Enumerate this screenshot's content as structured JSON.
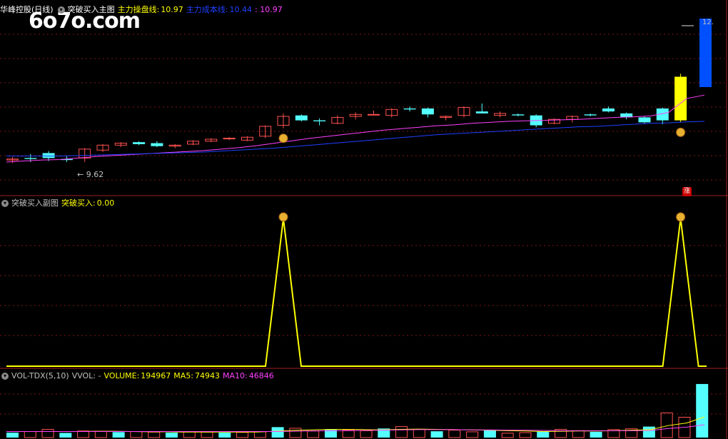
{
  "watermark": "6o7o.com",
  "main": {
    "stock_label": "华峰控股(日线)",
    "indicator_name": "突破买入主图",
    "line1_label": "主力操盘线:",
    "line1_value": "10.97",
    "line2_label": "主力成本线:",
    "line2_value": "10.44",
    "line2_value2": ": 10.97",
    "low_marker": "9.62",
    "high_marker": "12.",
    "zhang_label": "涨"
  },
  "sub": {
    "indicator_name": "突破买入副图",
    "signal_label": "突破买入:",
    "signal_value": "0.00"
  },
  "vol": {
    "indicator_name": "VOL-TDX(5,10)",
    "vvol": "VVOL: -",
    "volume_label": "VOLUME:",
    "volume_value": "194967",
    "ma5_label": "MA5:",
    "ma5_value": "74943",
    "ma10_label": "MA10:",
    "ma10_value": "46846"
  },
  "colors": {
    "up": "#ff5050",
    "down": "#54ffff",
    "ma_pink": "#ff40ff",
    "ma_blue": "#2040ff",
    "signal": "#ffff00",
    "bullish_bar": "#ffff00",
    "blue_bar": "#0050ff"
  },
  "chart_data": {
    "type": "candlestick",
    "ylim": [
      9.0,
      12.6
    ],
    "candles": [
      {
        "o": 9.66,
        "h": 9.72,
        "l": 9.6,
        "c": 9.68
      },
      {
        "o": 9.7,
        "h": 9.78,
        "l": 9.62,
        "c": 9.68
      },
      {
        "o": 9.8,
        "h": 9.84,
        "l": 9.64,
        "c": 9.7
      },
      {
        "o": 9.68,
        "h": 9.74,
        "l": 9.62,
        "c": 9.66
      },
      {
        "o": 9.7,
        "h": 9.9,
        "l": 9.62,
        "c": 9.88
      },
      {
        "o": 9.86,
        "h": 9.98,
        "l": 9.82,
        "c": 9.96
      },
      {
        "o": 9.96,
        "h": 10.02,
        "l": 9.92,
        "c": 10.0
      },
      {
        "o": 10.02,
        "h": 10.04,
        "l": 9.96,
        "c": 9.98
      },
      {
        "o": 10.0,
        "h": 10.04,
        "l": 9.92,
        "c": 9.94
      },
      {
        "o": 9.94,
        "h": 9.98,
        "l": 9.9,
        "c": 9.96
      },
      {
        "o": 9.98,
        "h": 10.06,
        "l": 9.96,
        "c": 10.04
      },
      {
        "o": 10.04,
        "h": 10.1,
        "l": 10.02,
        "c": 10.08
      },
      {
        "o": 10.1,
        "h": 10.12,
        "l": 10.06,
        "c": 10.1
      },
      {
        "o": 10.06,
        "h": 10.14,
        "l": 10.04,
        "c": 10.12
      },
      {
        "o": 10.14,
        "h": 10.36,
        "l": 10.1,
        "c": 10.34
      },
      {
        "o": 10.36,
        "h": 10.6,
        "l": 10.3,
        "c": 10.54
      },
      {
        "o": 10.56,
        "h": 10.58,
        "l": 10.44,
        "c": 10.46
      },
      {
        "o": 10.46,
        "h": 10.5,
        "l": 10.36,
        "c": 10.44
      },
      {
        "o": 10.4,
        "h": 10.56,
        "l": 10.38,
        "c": 10.52
      },
      {
        "o": 10.54,
        "h": 10.62,
        "l": 10.48,
        "c": 10.58
      },
      {
        "o": 10.58,
        "h": 10.66,
        "l": 10.56,
        "c": 10.58
      },
      {
        "o": 10.56,
        "h": 10.7,
        "l": 10.52,
        "c": 10.68
      },
      {
        "o": 10.7,
        "h": 10.74,
        "l": 10.64,
        "c": 10.68
      },
      {
        "o": 10.7,
        "h": 10.72,
        "l": 10.52,
        "c": 10.58
      },
      {
        "o": 10.52,
        "h": 10.56,
        "l": 10.46,
        "c": 10.54
      },
      {
        "o": 10.56,
        "h": 10.74,
        "l": 10.52,
        "c": 10.72
      },
      {
        "o": 10.64,
        "h": 10.8,
        "l": 10.6,
        "c": 10.6
      },
      {
        "o": 10.56,
        "h": 10.64,
        "l": 10.52,
        "c": 10.6
      },
      {
        "o": 10.58,
        "h": 10.6,
        "l": 10.54,
        "c": 10.56
      },
      {
        "o": 10.56,
        "h": 10.58,
        "l": 10.32,
        "c": 10.36
      },
      {
        "o": 10.4,
        "h": 10.5,
        "l": 10.38,
        "c": 10.48
      },
      {
        "o": 10.48,
        "h": 10.56,
        "l": 10.42,
        "c": 10.54
      },
      {
        "o": 10.58,
        "h": 10.6,
        "l": 10.54,
        "c": 10.56
      },
      {
        "o": 10.7,
        "h": 10.74,
        "l": 10.62,
        "c": 10.64
      },
      {
        "o": 10.6,
        "h": 10.62,
        "l": 10.48,
        "c": 10.52
      },
      {
        "o": 10.52,
        "h": 10.54,
        "l": 10.4,
        "c": 10.42
      },
      {
        "o": 10.7,
        "h": 10.72,
        "l": 10.38,
        "c": 10.46
      },
      {
        "o": 10.46,
        "h": 11.4,
        "l": 10.42,
        "c": 11.34
      }
    ],
    "ma_pink": [
      9.62,
      9.64,
      9.66,
      9.67,
      9.7,
      9.73,
      9.75,
      9.77,
      9.79,
      9.81,
      9.83,
      9.85,
      9.88,
      9.91,
      9.95,
      10.0,
      10.05,
      10.1,
      10.14,
      10.18,
      10.22,
      10.26,
      10.29,
      10.32,
      10.35,
      10.37,
      10.4,
      10.42,
      10.44,
      10.45,
      10.46,
      10.47,
      10.48,
      10.5,
      10.52,
      10.53,
      10.55,
      10.62,
      10.9,
      10.97
    ],
    "ma_blue": [
      9.74,
      9.74,
      9.74,
      9.74,
      9.75,
      9.76,
      9.77,
      9.78,
      9.79,
      9.8,
      9.81,
      9.82,
      9.84,
      9.86,
      9.88,
      9.9,
      9.93,
      9.96,
      9.99,
      10.02,
      10.05,
      10.08,
      10.11,
      10.14,
      10.17,
      10.19,
      10.21,
      10.23,
      10.25,
      10.27,
      10.29,
      10.31,
      10.33,
      10.34,
      10.36,
      10.38,
      10.4,
      10.41,
      10.43,
      10.44
    ],
    "buy_signals": [
      15,
      37
    ],
    "volume": {
      "values": [
        18000,
        22000,
        30000,
        17000,
        24000,
        22000,
        20000,
        22000,
        20000,
        18000,
        21000,
        20000,
        18000,
        19000,
        22000,
        38000,
        34000,
        24000,
        30000,
        27000,
        25000,
        33000,
        40000,
        30000,
        23000,
        27000,
        21000,
        28000,
        16000,
        18000,
        22000,
        30000,
        25000,
        21000,
        29000,
        32000,
        40000,
        90000,
        74000,
        194967
      ],
      "ma5": [
        22000,
        22000,
        22000,
        22000,
        22000,
        23000,
        23000,
        22000,
        21000,
        21000,
        20000,
        20000,
        20000,
        20000,
        20000,
        23000,
        26000,
        28000,
        30000,
        30000,
        29000,
        28000,
        30000,
        31000,
        30000,
        29000,
        28000,
        27000,
        25000,
        24000,
        22000,
        23000,
        24000,
        24000,
        25000,
        27000,
        29000,
        44000,
        53000,
        74943
      ],
      "ma10": [
        22000,
        22000,
        22000,
        22000,
        22000,
        22000,
        22000,
        22000,
        22000,
        22000,
        22000,
        22000,
        22000,
        22000,
        22000,
        22000,
        23000,
        24000,
        25000,
        25000,
        26000,
        27000,
        28000,
        29000,
        29000,
        29000,
        28000,
        28000,
        27000,
        27000,
        26000,
        25000,
        25000,
        25000,
        25000,
        25000,
        26000,
        33000,
        38000,
        46846
      ],
      "max": 200000
    }
  }
}
